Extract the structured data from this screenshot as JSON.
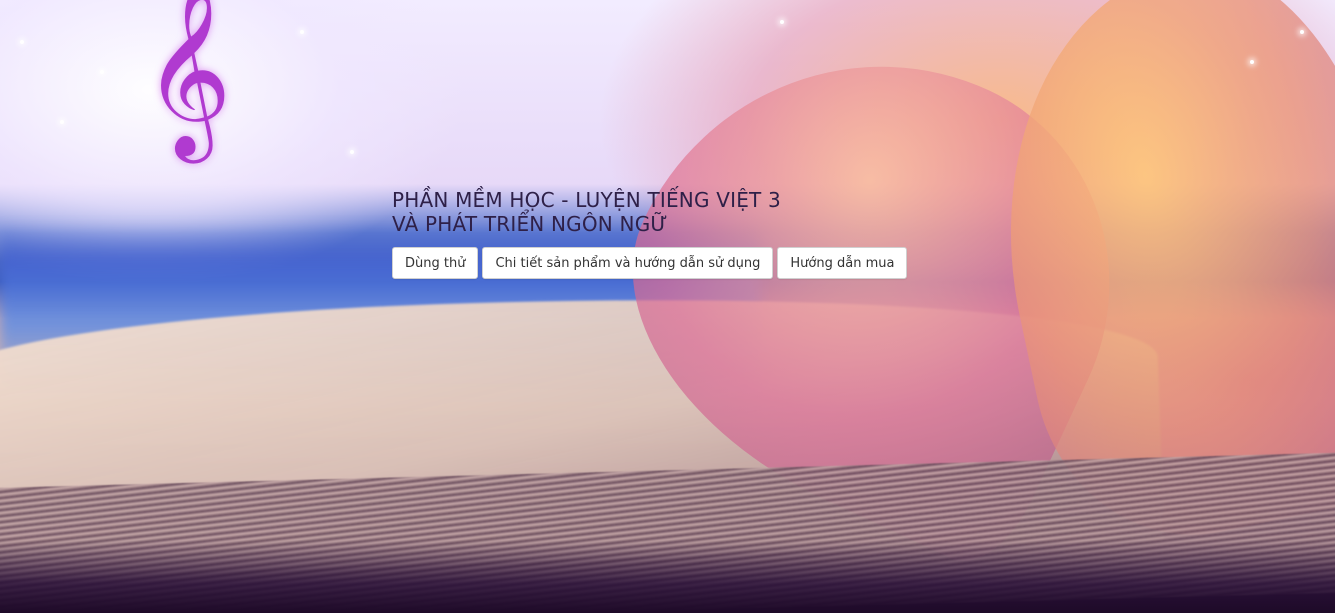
{
  "hero": {
    "title_line1": "PHẦN MỀM HỌC - LUYỆN TIẾNG VIỆT 3",
    "title_line2": "VÀ PHÁT TRIỂN NGÔN NGỮ",
    "background_image": "open-book-heart-music-clef",
    "icons": [
      "treble-clef-icon"
    ],
    "title_color": "#2e2048"
  },
  "buttons": {
    "try_label": "Dùng thử",
    "details_label": "Chi tiết sản phẩm và hướng dẫn sử dụng",
    "purchase_label": "Hướng dẫn mua"
  }
}
